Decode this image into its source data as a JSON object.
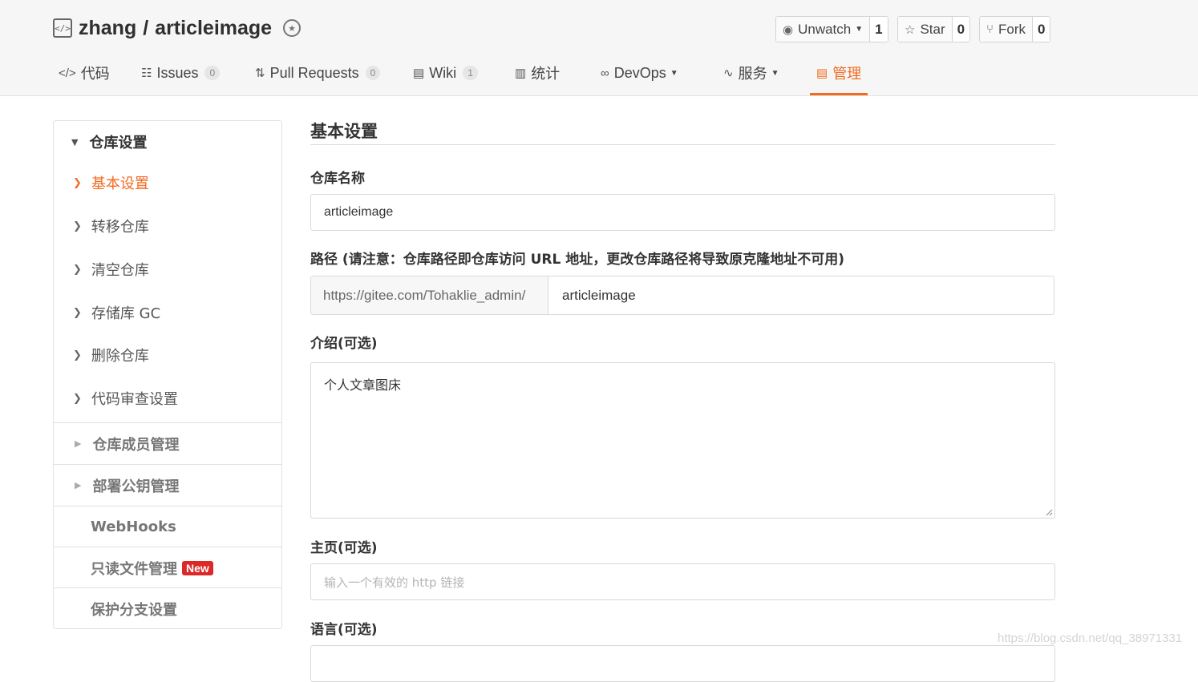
{
  "repo": {
    "owner": "zhang",
    "separator": "/",
    "name": "articleimage"
  },
  "actions": {
    "watch": {
      "label": "Unwatch",
      "count": "1"
    },
    "star": {
      "label": "Star",
      "count": "0"
    },
    "fork": {
      "label": "Fork",
      "count": "0"
    }
  },
  "tabs": [
    {
      "label": "代码",
      "icon": "code-icon"
    },
    {
      "label": "Issues",
      "count": "0",
      "icon": "issues-icon"
    },
    {
      "label": "Pull Requests",
      "count": "0",
      "icon": "pull-request-icon"
    },
    {
      "label": "Wiki",
      "count": "1",
      "icon": "book-icon"
    },
    {
      "label": "统计",
      "icon": "bar-chart-icon"
    },
    {
      "label": "DevOps",
      "icon": "infinity-icon"
    },
    {
      "label": "服务",
      "icon": "pulse-icon"
    },
    {
      "label": "管理",
      "icon": "settings-doc-icon",
      "active": true
    }
  ],
  "sidebar": {
    "group_title": "仓库设置",
    "items": [
      {
        "label": "基本设置",
        "active": true
      },
      {
        "label": "转移仓库"
      },
      {
        "label": "清空仓库"
      },
      {
        "label": "存储库 GC"
      },
      {
        "label": "删除仓库"
      },
      {
        "label": "代码审查设置"
      }
    ],
    "sections": [
      {
        "label": "仓库成员管理"
      },
      {
        "label": "部署公钥管理"
      },
      {
        "label": "WebHooks"
      },
      {
        "label": "只读文件管理",
        "badge": "New"
      },
      {
        "label": "保护分支设置"
      }
    ]
  },
  "main": {
    "title": "基本设置",
    "repo_name_label": "仓库名称",
    "repo_name_value": "articleimage",
    "path_label": "路径 (请注意：仓库路径即仓库访问 URL 地址，更改仓库路径将导致原克隆地址不可用)",
    "path_prefix": "https://gitee.com/Tohaklie_admin/",
    "path_value": "articleimage",
    "intro_label": "介绍(可选)",
    "intro_value": "个人文章图床",
    "homepage_label": "主页(可选)",
    "homepage_placeholder": "输入一个有效的 http 链接",
    "language_label": "语言(可选)"
  },
  "watermark": "https://blog.csdn.net/qq_38971331",
  "colors": {
    "accent": "#f26b22",
    "new_badge": "#db2828"
  }
}
